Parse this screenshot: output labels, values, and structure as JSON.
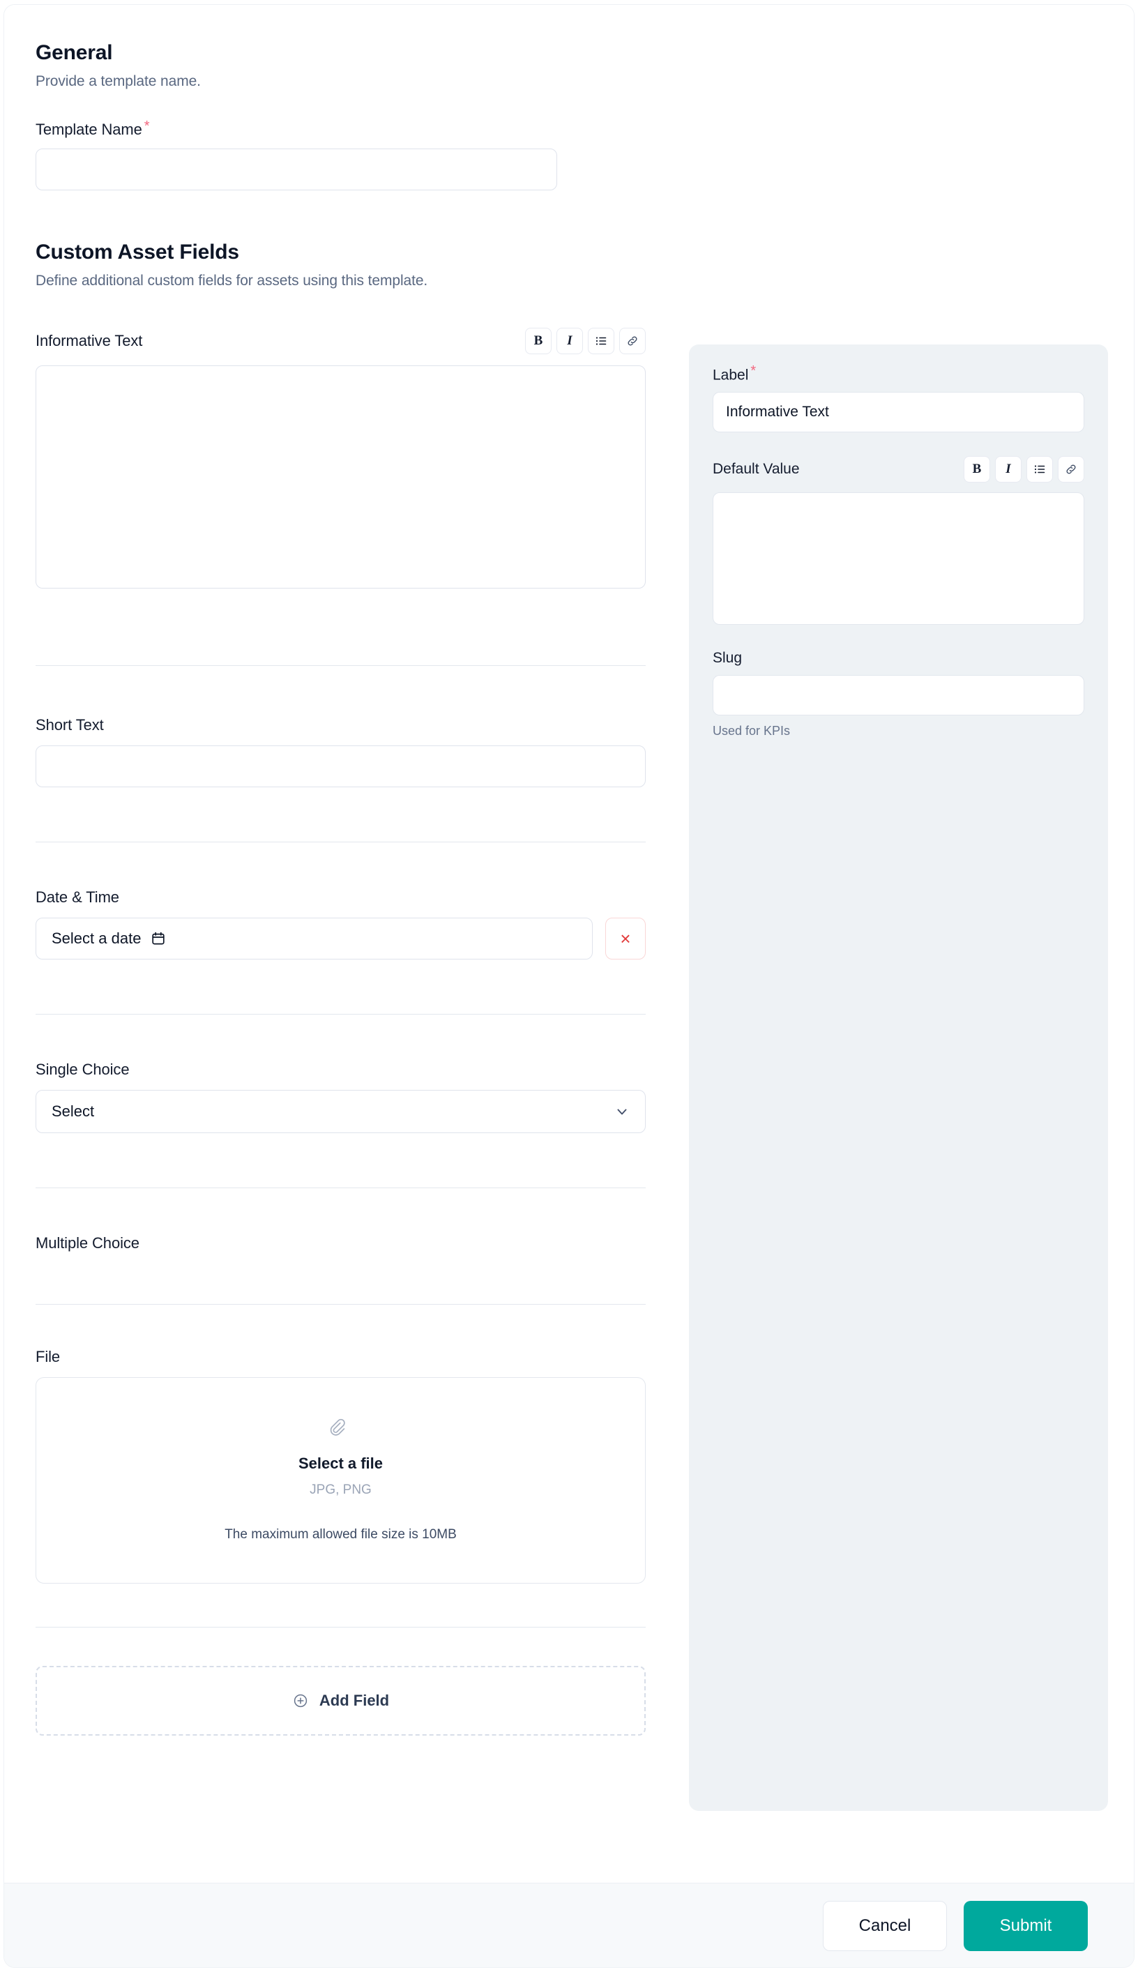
{
  "general": {
    "title": "General",
    "subtitle": "Provide a template name.",
    "template_name_label": "Template Name",
    "required_mark": "*",
    "template_name_value": "",
    "template_name_placeholder": ""
  },
  "custom_fields": {
    "title": "Custom Asset Fields",
    "subtitle": "Define additional custom fields for assets using this template.",
    "fields": [
      {
        "label": "Informative Text",
        "type": "rich-text",
        "value": ""
      },
      {
        "label": "Short Text",
        "type": "text",
        "value": ""
      },
      {
        "label": "Date & Time",
        "type": "date",
        "placeholder": "Select a date",
        "clear_label": "×"
      },
      {
        "label": "Single Choice",
        "type": "select",
        "selected": "Select"
      },
      {
        "label": "Multiple Choice",
        "type": "multi-select"
      },
      {
        "label": "File",
        "type": "file"
      }
    ],
    "file_drop": {
      "title": "Select a file",
      "types": "JPG, PNG",
      "max_size": "The maximum allowed file size is 10MB"
    },
    "add_field_label": "Add Field"
  },
  "rich_text_toolbar": {
    "bold": "B",
    "italic": "I",
    "list": "list-icon",
    "link": "link-icon"
  },
  "inspector": {
    "label_label": "Label",
    "label_required": "*",
    "label_value": "Informative Text",
    "default_value_label": "Default Value",
    "default_value": "",
    "slug_label": "Slug",
    "slug_value": "",
    "slug_help": "Used for KPIs"
  },
  "footer": {
    "cancel_label": "Cancel",
    "submit_label": "Submit"
  },
  "colors": {
    "accent": "#00a99d",
    "required": "#f2677f",
    "danger": "#e23b3b",
    "panel_bg": "#eef2f5",
    "footer_bg": "#f7f9fb"
  }
}
